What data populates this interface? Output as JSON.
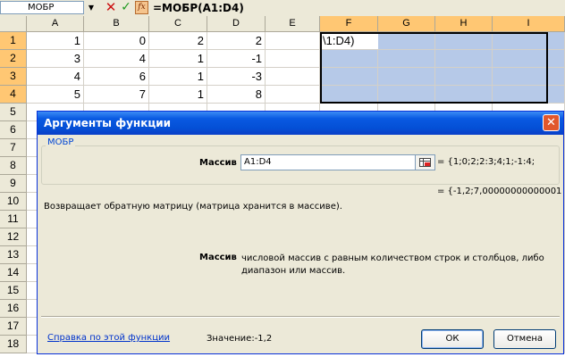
{
  "formula_bar": {
    "name_box": "МОБР",
    "formula": "=МОБР(A1:D4)",
    "fx_label": "fx"
  },
  "grid": {
    "columns": [
      "A",
      "B",
      "C",
      "D",
      "E",
      "F",
      "G",
      "H",
      "I"
    ],
    "selected_columns": [
      "F",
      "G",
      "H",
      "I"
    ],
    "rows": [
      "1",
      "2",
      "3",
      "4",
      "5",
      "6",
      "7",
      "8",
      "9",
      "10",
      "11",
      "12",
      "13",
      "14",
      "15",
      "16",
      "17",
      "18"
    ],
    "selected_rows": [
      "1",
      "2",
      "3",
      "4"
    ],
    "cells": [
      [
        "1",
        "0",
        "2",
        "2"
      ],
      [
        "3",
        "4",
        "1",
        "-1"
      ],
      [
        "4",
        "6",
        "1",
        "-3"
      ],
      [
        "5",
        "7",
        "1",
        "8"
      ]
    ],
    "edit_cell_text": "\\1:D4)"
  },
  "dialog": {
    "title": "Аргументы функции",
    "function_name": "МОБР",
    "arg_label": "Массив",
    "arg_input_value": "A1:D4",
    "arg_value_preview": "= {1;0;2;2:3;4;1;-1:4;",
    "result_preview": "= {-1,2;7,00000000000001",
    "description": "Возвращает обратную матрицу (матрица хранится в массиве).",
    "param_name": "Массив",
    "param_description": "числовой массив с равным количеством строк и столбцов, либо диапазон или массив.",
    "help_link": "Справка по этой функции",
    "formula_result": "Значение:-1,2",
    "ok_label": "ОК",
    "cancel_label": "Отмена",
    "close_glyph": "✕"
  },
  "colors": {
    "titlebar": "#0a5ae2",
    "selection": "#b6c9e8",
    "header_selected": "#ffc773",
    "link": "#0033cc"
  }
}
